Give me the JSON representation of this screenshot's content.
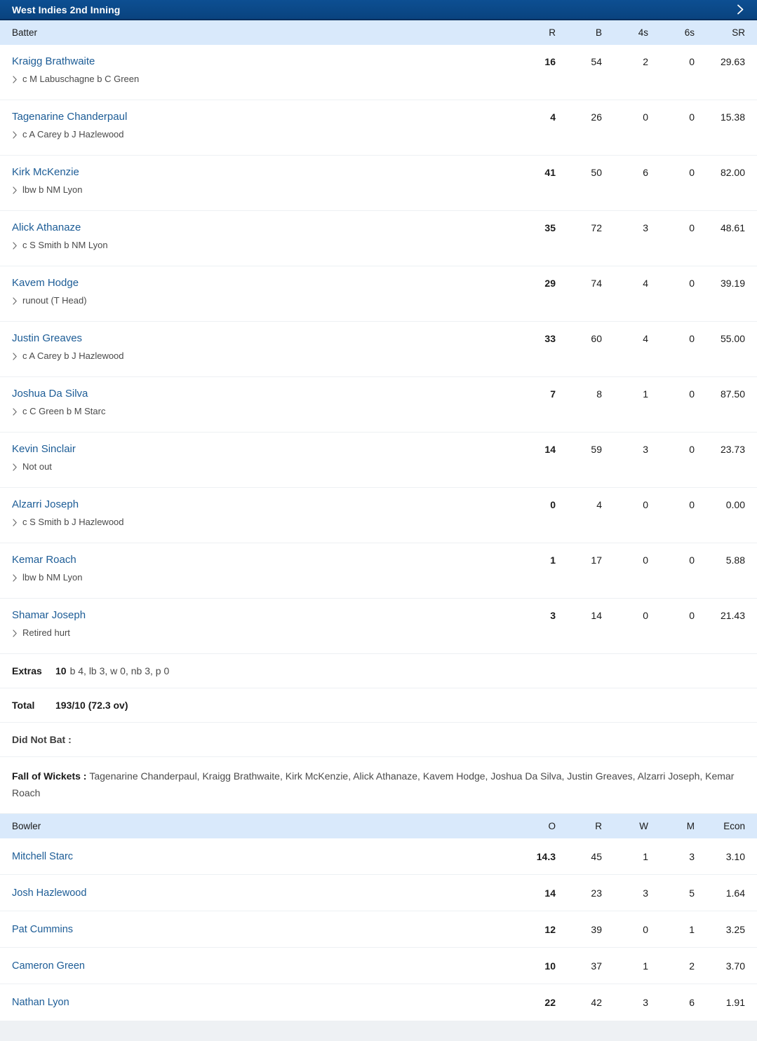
{
  "inning": {
    "title": "West Indies 2nd Inning",
    "expand_icon": "chevron-right-icon"
  },
  "batting": {
    "headers": {
      "name": "Batter",
      "runs": "R",
      "balls": "B",
      "fours": "4s",
      "sixes": "6s",
      "strike_rate": "SR"
    },
    "rows": [
      {
        "name": "Kraigg Brathwaite",
        "dismissal": "c M Labuschagne b C Green",
        "R": "16",
        "B": "54",
        "4s": "2",
        "6s": "0",
        "SR": "29.63"
      },
      {
        "name": "Tagenarine Chanderpaul",
        "dismissal": "c A Carey b J Hazlewood",
        "R": "4",
        "B": "26",
        "4s": "0",
        "6s": "0",
        "SR": "15.38"
      },
      {
        "name": "Kirk McKenzie",
        "dismissal": "lbw b NM Lyon",
        "R": "41",
        "B": "50",
        "4s": "6",
        "6s": "0",
        "SR": "82.00"
      },
      {
        "name": "Alick Athanaze",
        "dismissal": "c S Smith b NM Lyon",
        "R": "35",
        "B": "72",
        "4s": "3",
        "6s": "0",
        "SR": "48.61"
      },
      {
        "name": "Kavem Hodge",
        "dismissal": "runout (T Head)",
        "R": "29",
        "B": "74",
        "4s": "4",
        "6s": "0",
        "SR": "39.19"
      },
      {
        "name": "Justin Greaves",
        "dismissal": "c A Carey b J Hazlewood",
        "R": "33",
        "B": "60",
        "4s": "4",
        "6s": "0",
        "SR": "55.00"
      },
      {
        "name": "Joshua Da Silva",
        "dismissal": "c C Green b M Starc",
        "R": "7",
        "B": "8",
        "4s": "1",
        "6s": "0",
        "SR": "87.50"
      },
      {
        "name": "Kevin Sinclair",
        "dismissal": "Not out",
        "R": "14",
        "B": "59",
        "4s": "3",
        "6s": "0",
        "SR": "23.73"
      },
      {
        "name": "Alzarri Joseph",
        "dismissal": "c S Smith b J Hazlewood",
        "R": "0",
        "B": "4",
        "4s": "0",
        "6s": "0",
        "SR": "0.00"
      },
      {
        "name": "Kemar Roach",
        "dismissal": "lbw b NM Lyon",
        "R": "1",
        "B": "17",
        "4s": "0",
        "6s": "0",
        "SR": "5.88"
      },
      {
        "name": "Shamar Joseph",
        "dismissal": "Retired hurt",
        "R": "3",
        "B": "14",
        "4s": "0",
        "6s": "0",
        "SR": "21.43"
      }
    ]
  },
  "extras": {
    "label": "Extras",
    "total": "10",
    "detail": "b 4, lb 3, w 0, nb 3, p 0"
  },
  "total": {
    "label": "Total",
    "value": "193/10 (72.3 ov)"
  },
  "did_not_bat": {
    "label": "Did Not Bat :",
    "players": ""
  },
  "fall_of_wickets": {
    "label": "Fall of Wickets : ",
    "players": "Tagenarine Chanderpaul, Kraigg Brathwaite, Kirk McKenzie, Alick Athanaze, Kavem Hodge, Joshua Da Silva, Justin Greaves, Alzarri Joseph, Kemar Roach"
  },
  "bowling": {
    "headers": {
      "name": "Bowler",
      "overs": "O",
      "runs": "R",
      "wickets": "W",
      "maidens": "M",
      "economy": "Econ"
    },
    "rows": [
      {
        "name": "Mitchell Starc",
        "O": "14.3",
        "R": "45",
        "W": "1",
        "M": "3",
        "Econ": "3.10"
      },
      {
        "name": "Josh Hazlewood",
        "O": "14",
        "R": "23",
        "W": "3",
        "M": "5",
        "Econ": "1.64"
      },
      {
        "name": "Pat Cummins",
        "O": "12",
        "R": "39",
        "W": "0",
        "M": "1",
        "Econ": "3.25"
      },
      {
        "name": "Cameron Green",
        "O": "10",
        "R": "37",
        "W": "1",
        "M": "2",
        "Econ": "3.70"
      },
      {
        "name": "Nathan Lyon",
        "O": "22",
        "R": "42",
        "W": "3",
        "M": "6",
        "Econ": "1.91"
      }
    ]
  },
  "colors": {
    "header_blue": "#0a4b8c",
    "column_header_blue": "#d9e9fb",
    "link_blue": "#1c5c96"
  }
}
